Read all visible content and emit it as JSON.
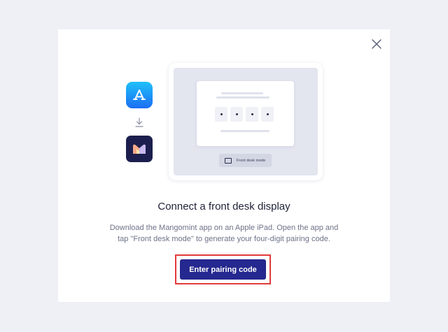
{
  "modal": {
    "title": "Connect a front desk display",
    "description_lines": [
      "Download the Mangomint app on an Apple iPad. Open the app and",
      "tap \"Front desk mode\" to generate your four-digit pairing code."
    ],
    "primary_button_label": "Enter pairing code",
    "close_icon": "close-icon"
  },
  "illustration": {
    "app_store_icon": "app-store-icon",
    "download_icon": "arrow-down-icon",
    "app_logo_icon": "mangomint-logo-icon",
    "pairing_digits": [
      "•",
      "•",
      "•",
      "•"
    ],
    "front_desk_label": "Front desk mode"
  },
  "colors": {
    "page_background": "#eff0f5",
    "primary_button": "#25288f",
    "highlight_border": "#e23a3a",
    "app_store_gradient": [
      "#1ec0fa",
      "#1b6ef3"
    ],
    "app_logo_background": "#1c1f4d"
  }
}
